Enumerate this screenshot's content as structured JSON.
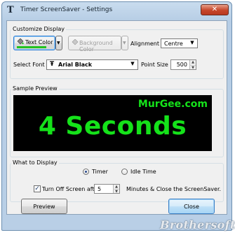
{
  "window": {
    "title": "Timer ScreenSaver - Settings",
    "title_icon": "T",
    "close_glyph": "✕"
  },
  "customize": {
    "group_label": "Customize Display",
    "text_color_label": "Text Color",
    "background_color_label": "Background Color",
    "alignment_label": "Alignment :",
    "alignment_value": "Centre",
    "select_font_label": "Select Font :",
    "font_icon": "Ŧ",
    "font_value": "Arial Black",
    "point_size_label": "Point Size",
    "point_size_value": "500",
    "text_color_swatch": "#22c21f"
  },
  "preview": {
    "group_label": "Sample Preview",
    "brand": "MurGee.com",
    "main_text": "4 Seconds",
    "text_color": "#15e21a",
    "background": "#000000"
  },
  "what_to_display": {
    "group_label": "What to Display",
    "options": [
      {
        "label": "Timer",
        "selected": true
      },
      {
        "label": "Idle Time",
        "selected": false
      }
    ],
    "turn_off_label": "Turn Off Screen after",
    "turn_off_checked": true,
    "minutes_value": "5",
    "minutes_suffix": "Minutes & Close the ScreenSaver."
  },
  "buttons": {
    "preview": "Preview",
    "close": "Close"
  },
  "watermark": "Brothersoft"
}
